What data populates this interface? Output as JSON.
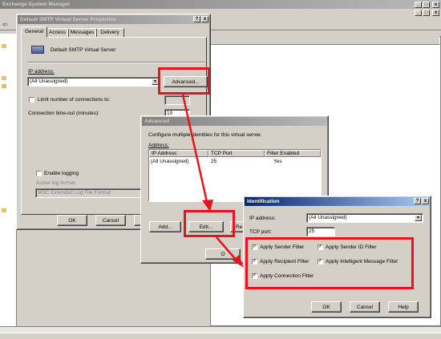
{
  "main_window": {
    "title": "Exchange System Manager"
  },
  "smtp_dialog": {
    "title": "Default SMTP Virtual Server Properties",
    "help": "?",
    "close": "x",
    "tabs": [
      "General",
      "Access",
      "Messages",
      "Delivery"
    ],
    "server_name": "Default SMTP Virtual Server",
    "ip_label": "IP address:",
    "ip_value": "(All Unassigned)",
    "advanced_button": "Advanced...",
    "limit_connections": "Limit number of connections to:",
    "timeout_label": "Connection time-out (minutes):",
    "timeout_value": "10",
    "enable_logging": "Enable logging",
    "log_format_label": "Active log format:",
    "log_format_value": "W3C Extended Log File Format",
    "ok": "OK",
    "cancel": "Cancel"
  },
  "advanced_dialog": {
    "title": "Advanced",
    "description": "Configure multiple identities for this virtual server.",
    "address_label": "Address:",
    "columns": [
      "IP Address",
      "TCP Port",
      "Filter Enabled"
    ],
    "rows": [
      [
        "(All Unassigned)",
        "25",
        "Yes"
      ]
    ],
    "add_button": "Add...",
    "edit_button": "Edit...",
    "remove_partial": "Re",
    "ok_partial": "O"
  },
  "identification_dialog": {
    "title": "Identification",
    "help": "?",
    "close": "x",
    "ip_label": "IP address:",
    "ip_value": "(All Unassigned)",
    "port_label": "TCP port:",
    "port_value": "25",
    "filters": {
      "sender": "Apply Sender Filter",
      "sender_id": "Apply Sender ID Filter",
      "recipient": "Apply Recipient Filter",
      "intelligent": "Apply Intelligent Message Filter",
      "connection": "Apply Connection Filter"
    },
    "check_mark": "✓",
    "ok": "OK",
    "cancel": "Cancel",
    "help_button": "Help"
  },
  "colors": {
    "highlight": "#e8141d",
    "title_active": "#0a246a"
  }
}
